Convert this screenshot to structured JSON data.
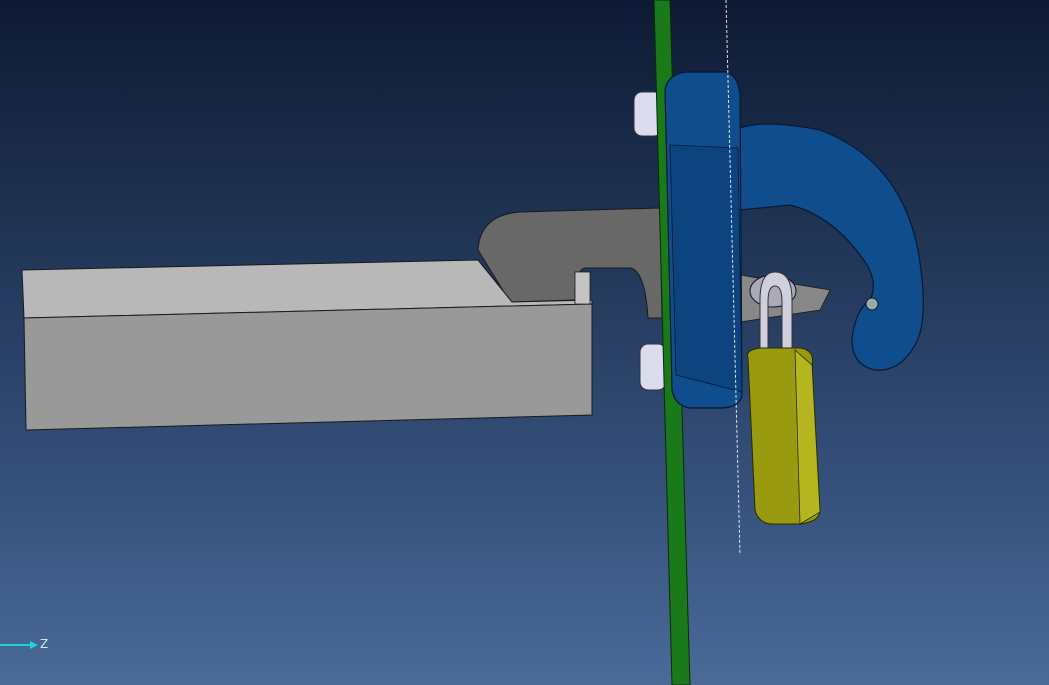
{
  "viewport": {
    "axis_indicator": {
      "label": "Z",
      "color": "#19d6d6"
    },
    "colors": {
      "background_top": "#0e1a33",
      "background_bottom": "#4a6a98",
      "panel": "#1a7a1a",
      "bracket": "#0f4d8c",
      "lever": "#9a9a9a",
      "padlock_body": "#9a9a10",
      "shackle": "#d0d0dc",
      "bolt": "#dcdcee"
    }
  }
}
